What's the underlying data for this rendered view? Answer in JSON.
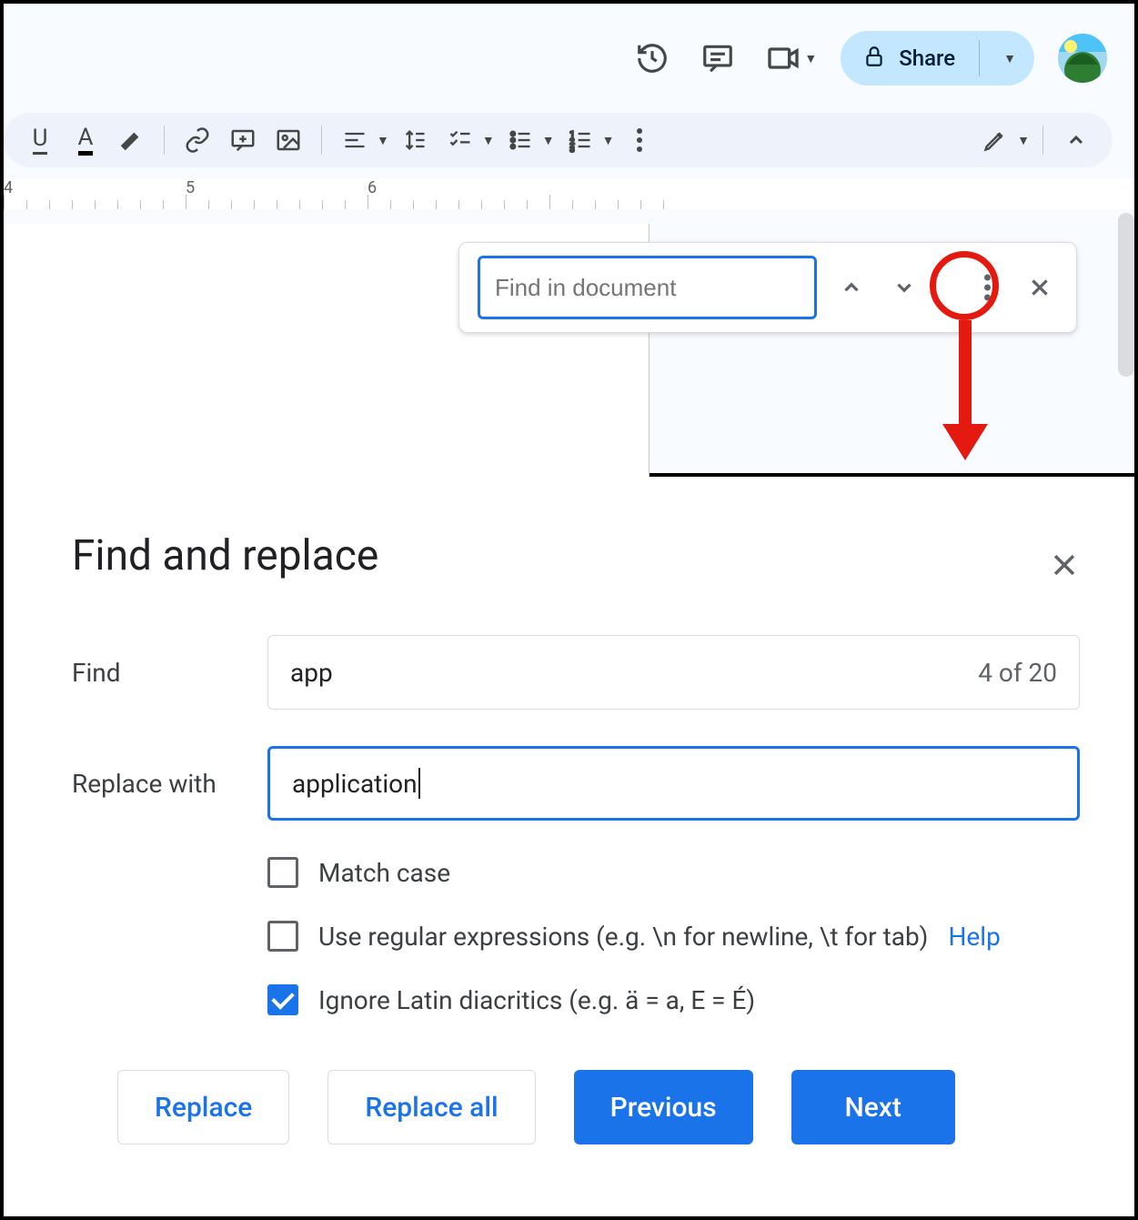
{
  "header": {
    "share_label": "Share"
  },
  "ruler": {
    "n4": "4",
    "n5": "5",
    "n6": "6"
  },
  "findbar": {
    "placeholder": "Find in document"
  },
  "dialog": {
    "title": "Find and replace",
    "find_label": "Find",
    "find_value": "app",
    "count": "4 of 20",
    "replace_label": "Replace with",
    "replace_value": "application",
    "opt_match_case": "Match case",
    "opt_regex": "Use regular expressions (e.g. \\n for newline, \\t for tab) ",
    "help": "Help",
    "opt_diacritics": "Ignore Latin diacritics (e.g. ä = a, E = É)",
    "btn_replace": "Replace",
    "btn_replace_all": "Replace all",
    "btn_previous": "Previous",
    "btn_next": "Next"
  }
}
